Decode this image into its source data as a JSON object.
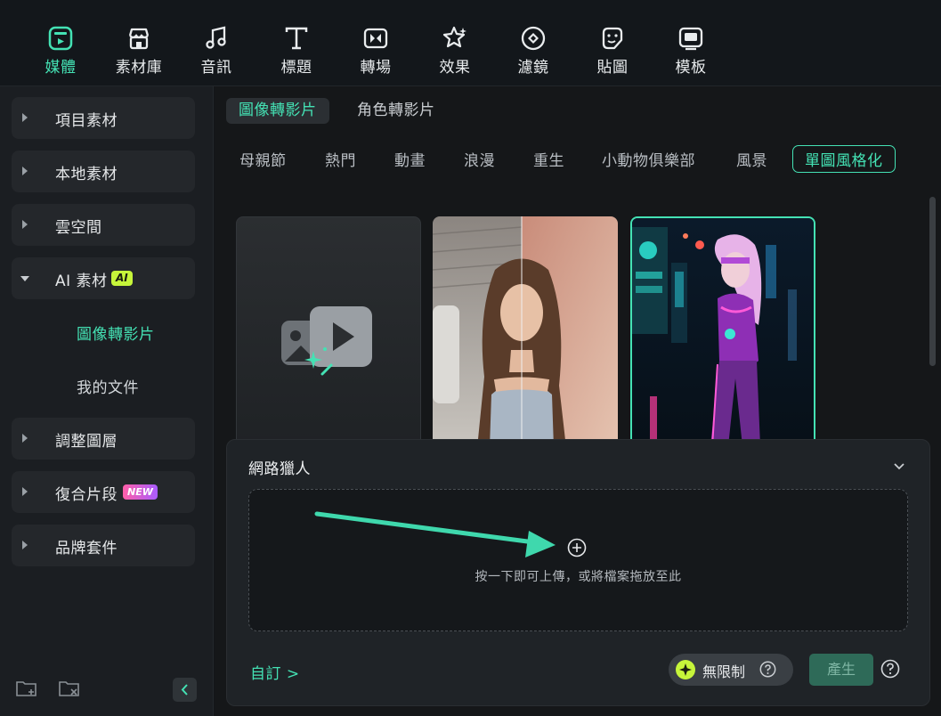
{
  "toolbar": {
    "items": [
      {
        "label": "媒體",
        "icon": "media-icon",
        "active": true
      },
      {
        "label": "素材庫",
        "icon": "store-icon",
        "active": false
      },
      {
        "label": "音訊",
        "icon": "music-note-icon",
        "active": false
      },
      {
        "label": "標題",
        "icon": "text-t-icon",
        "active": false
      },
      {
        "label": "轉場",
        "icon": "transition-icon",
        "active": false
      },
      {
        "label": "效果",
        "icon": "effects-star-icon",
        "active": false
      },
      {
        "label": "濾鏡",
        "icon": "filter-icon",
        "active": false
      },
      {
        "label": "貼圖",
        "icon": "sticker-icon",
        "active": false
      },
      {
        "label": "模板",
        "icon": "template-icon",
        "active": false
      }
    ]
  },
  "sidebar": {
    "items": [
      {
        "label": "項目素材",
        "expanded": false
      },
      {
        "label": "本地素材",
        "expanded": false
      },
      {
        "label": "雲空間",
        "expanded": false
      },
      {
        "label": "AI 素材",
        "badge": "AI",
        "expanded": true
      },
      {
        "label": "調整圖層",
        "expanded": false
      },
      {
        "label": "復合片段",
        "badge": "NEW",
        "expanded": false
      },
      {
        "label": "品牌套件",
        "expanded": false
      }
    ],
    "sub_items": [
      {
        "label": "圖像轉影片",
        "active": true
      },
      {
        "label": "我的文件",
        "active": false
      }
    ]
  },
  "main": {
    "tabs": [
      {
        "label": "圖像轉影片",
        "active": true
      },
      {
        "label": "角色轉影片",
        "active": false
      }
    ],
    "categories": [
      {
        "label": "母親節",
        "active": false
      },
      {
        "label": "熱門",
        "active": false
      },
      {
        "label": "動畫",
        "active": false
      },
      {
        "label": "浪漫",
        "active": false
      },
      {
        "label": "重生",
        "active": false
      },
      {
        "label": "小動物俱樂部",
        "active": false
      },
      {
        "label": "風景",
        "active": false
      },
      {
        "label": "單圖風格化",
        "active": true
      }
    ]
  },
  "panel": {
    "title": "網路獵人",
    "dropzone_text": "按一下即可上傳，或將檔案拖放至此",
    "custom_link": "自訂 >",
    "unlimited_label": "無限制",
    "generate_label": "產生"
  },
  "colors": {
    "accent": "#44e2b4",
    "badge_ai": "#c6f53a",
    "generate_bg": "#2e6a58"
  }
}
